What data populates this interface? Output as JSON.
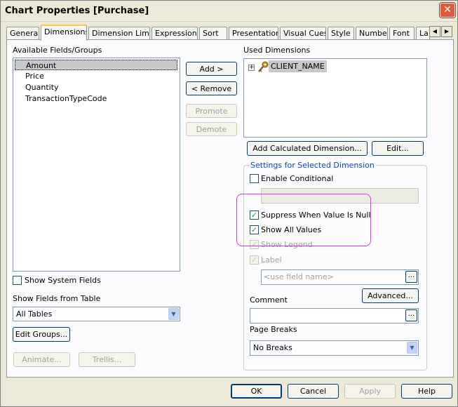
{
  "window": {
    "title": "Chart Properties [Purchase]"
  },
  "tabs": [
    {
      "label": "General"
    },
    {
      "label": "Dimensions"
    },
    {
      "label": "Dimension Limits"
    },
    {
      "label": "Expressions"
    },
    {
      "label": "Sort"
    },
    {
      "label": "Presentation"
    },
    {
      "label": "Visual Cues"
    },
    {
      "label": "Style"
    },
    {
      "label": "Number"
    },
    {
      "label": "Font"
    },
    {
      "label": "La"
    }
  ],
  "available": {
    "label": "Available Fields/Groups",
    "items": [
      "Amount",
      "Price",
      "Quantity",
      "TransactionTypeCode"
    ],
    "selected_index": 0
  },
  "show_system_fields": {
    "label": "Show System Fields",
    "checked": false
  },
  "show_fields_from_table": {
    "label": "Show Fields from Table",
    "value": "All Tables"
  },
  "buttons": {
    "add": "Add >",
    "remove": "< Remove",
    "promote": "Promote",
    "demote": "Demote",
    "edit_groups": "Edit Groups...",
    "animate": "Animate...",
    "trellis": "Trellis...",
    "add_calculated": "Add Calculated Dimension...",
    "edit": "Edit...",
    "advanced": "Advanced...",
    "ellipsis": "..."
  },
  "used": {
    "label": "Used Dimensions",
    "items": [
      "CLIENT_NAME"
    ]
  },
  "settings": {
    "legend": "Settings for Selected Dimension",
    "enable_conditional": {
      "label": "Enable Conditional",
      "checked": false
    },
    "suppress_null": {
      "label": "Suppress When Value Is Null",
      "checked": true
    },
    "show_all_values": {
      "label": "Show All Values",
      "checked": true
    },
    "show_legend": {
      "label": "Show Legend",
      "checked": true
    },
    "label_opt": {
      "label": "Label",
      "checked": true
    },
    "label_placeholder": "<use field name>",
    "comment_label": "Comment",
    "page_breaks_label": "Page Breaks",
    "page_breaks_value": "No Breaks"
  },
  "footer": {
    "ok": "OK",
    "cancel": "Cancel",
    "apply": "Apply",
    "help": "Help"
  }
}
